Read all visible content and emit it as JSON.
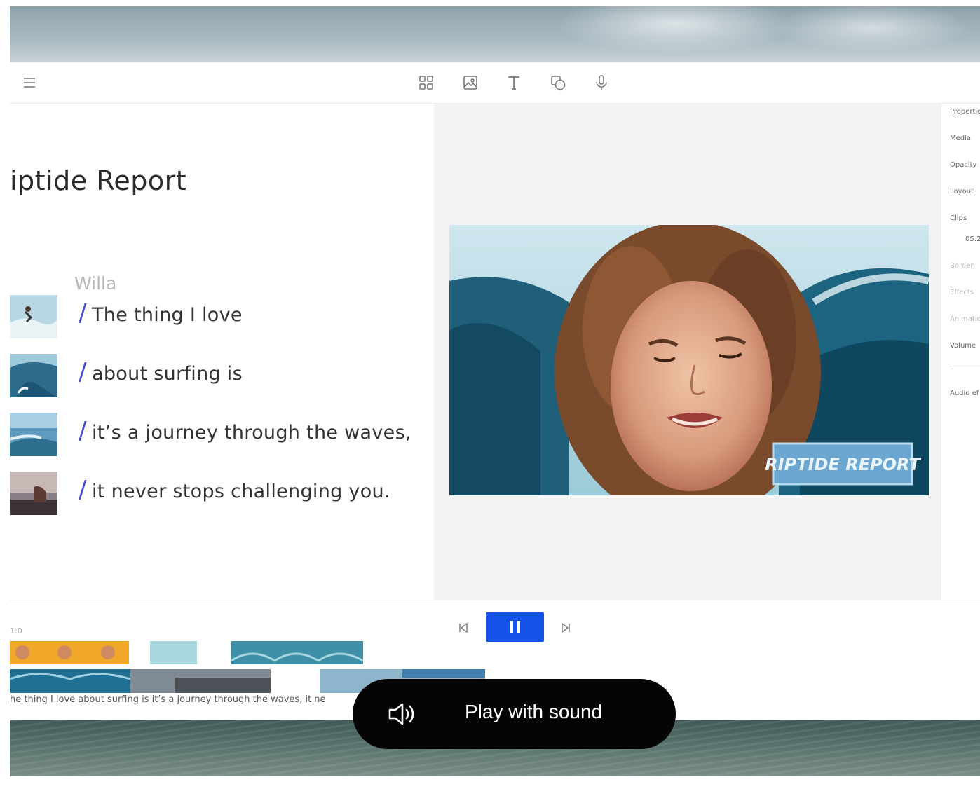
{
  "toolbar": {
    "menu_icon": "hamburger-menu-icon",
    "tools": [
      "grid-icon",
      "image-icon",
      "text-icon",
      "shapes-icon",
      "microphone-icon"
    ]
  },
  "script": {
    "title": "iptide Report",
    "speaker": "Willa",
    "lines": [
      {
        "text": "The thing I love"
      },
      {
        "text": "about surfing is"
      },
      {
        "text": "it’s a journey through the waves,"
      },
      {
        "text": "it never stops challenging you."
      }
    ]
  },
  "preview": {
    "overlay_title": "RIPTIDE REPORT"
  },
  "properties_panel": {
    "items": [
      "Properties",
      "Media",
      "Opacity",
      "Layout",
      "Clips",
      "05:2",
      "Border",
      "Effects",
      "Animation",
      "Volume",
      "Audio ef"
    ]
  },
  "timeline": {
    "label": "1:0",
    "transcript": "he thing I love about surfing is it’s a journey through the waves, it ne"
  },
  "play_overlay": {
    "label": "Play with sound"
  },
  "colors": {
    "accent": "#1552e8",
    "slash": "#4b4fd6",
    "pill": "#050505"
  }
}
